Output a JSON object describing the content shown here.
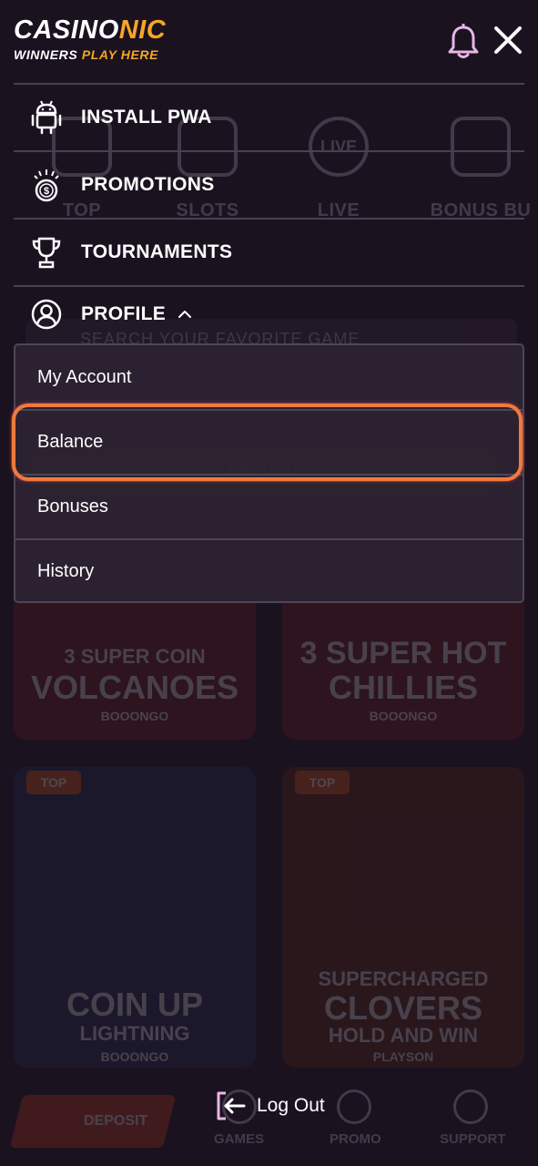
{
  "header": {
    "logo": {
      "part1": "CASINO",
      "part2": "NIC",
      "tag1": "WINNERS ",
      "tag2": "PLAY HERE"
    }
  },
  "menu": {
    "items": [
      {
        "label": "INSTALL PWA",
        "icon": "android-icon"
      },
      {
        "label": "PROMOTIONS",
        "icon": "money-bag-icon"
      },
      {
        "label": "TOURNAMENTS",
        "icon": "trophy-icon"
      },
      {
        "label": "PROFILE",
        "icon": "user-circle-icon",
        "expanded": true
      }
    ],
    "profile_submenu": [
      {
        "label": "My Account"
      },
      {
        "label": "Balance",
        "highlighted": true
      },
      {
        "label": "Bonuses"
      },
      {
        "label": "History"
      }
    ],
    "logout_label": "Log Out"
  },
  "background": {
    "categories": [
      "TOP",
      "SLOTS",
      "LIVE",
      "BONUS BU"
    ],
    "live_icon_text": "LIVE",
    "search_placeholder": "SEARCH YOUR FAVORITE GAME",
    "deposit_label": "DEPOSIT",
    "games": [
      {
        "line1": "3 SUPER COIN",
        "line2": "VOLCANOES",
        "provider": "BOOONGO"
      },
      {
        "line1": "3 SUPER HOT",
        "line2": "CHILLIES",
        "provider": "BOOONGO"
      },
      {
        "badge": "TOP",
        "line1": "COIN UP",
        "line2": "LIGHTNING",
        "provider": "BOOONGO"
      },
      {
        "badge": "TOP",
        "line1": "SUPERCHARGED",
        "line2": "CLOVERS",
        "line3": "HOLD AND WIN",
        "provider": "PLAYSON"
      }
    ],
    "bottom_nav": [
      "GAMES",
      "PROMO",
      "SUPPORT"
    ],
    "bottom_deposit": "DEPOSIT"
  },
  "colors": {
    "accent": "#f5a623",
    "highlight": "#f07a3c",
    "bg": "#1b1220"
  }
}
